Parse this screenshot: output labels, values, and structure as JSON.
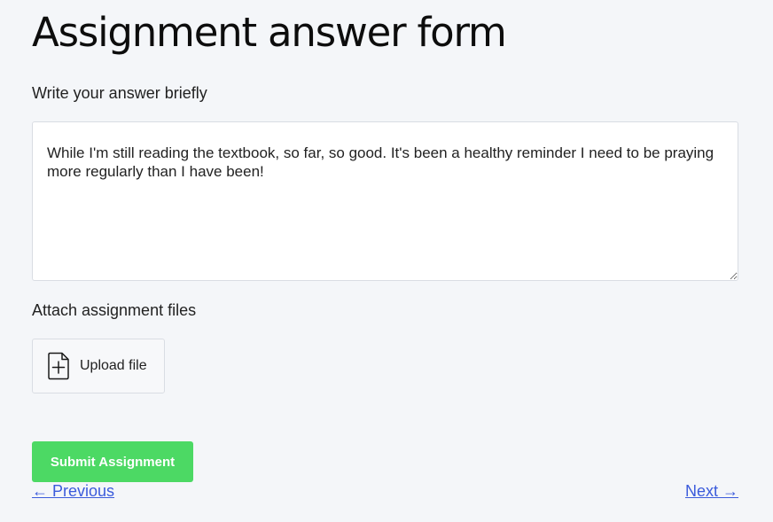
{
  "page": {
    "title": "Assignment answer form"
  },
  "answer": {
    "label": "Write your answer briefly",
    "value": "While I'm still reading the textbook, so far, so good. It's been a healthy reminder I need to be praying more regularly than I have been!"
  },
  "attachments": {
    "label": "Attach assignment files",
    "upload_label": "Upload file",
    "upload_icon": "file-plus-icon"
  },
  "actions": {
    "submit_label": "Submit Assignment",
    "submit_color": "#4cd964"
  },
  "navigation": {
    "previous_label": "← Previous",
    "next_label": "Next →",
    "link_color": "#3b5bdb"
  }
}
